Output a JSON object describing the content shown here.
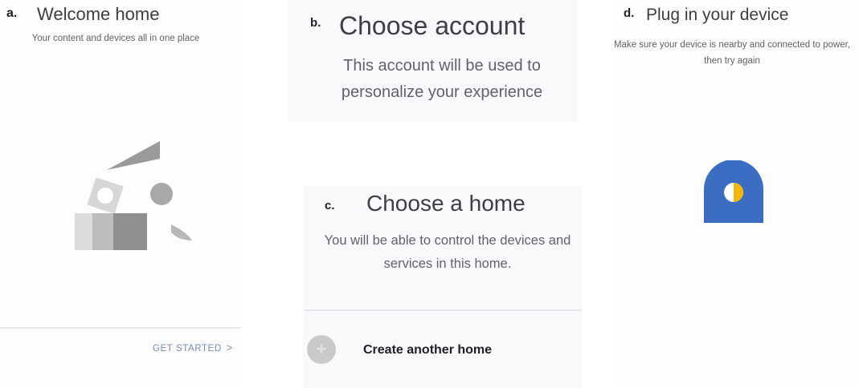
{
  "panel_a": {
    "letter": "a.",
    "title": "Welcome home",
    "subtitle": "Your content and devices all in one place",
    "get_started": "GET STARTED",
    "chevron": ">"
  },
  "panel_b": {
    "letter": "b.",
    "title": "Choose account",
    "subtitle": "This account will be used to personalize your experience"
  },
  "panel_c": {
    "letter": "c.",
    "title": "Choose a home",
    "subtitle": "You will be able to control the devices and services in this home.",
    "add_icon": "+",
    "create_home": "Create another home"
  },
  "panel_d": {
    "letter": "d.",
    "title": "Plug in your device",
    "subtitle": "Make sure your device is nearby and connected to power, then try again"
  },
  "colors": {
    "accent_blue": "#3b6ec2",
    "device_yellow": "#f2b705",
    "link": "#7a8ab8"
  }
}
